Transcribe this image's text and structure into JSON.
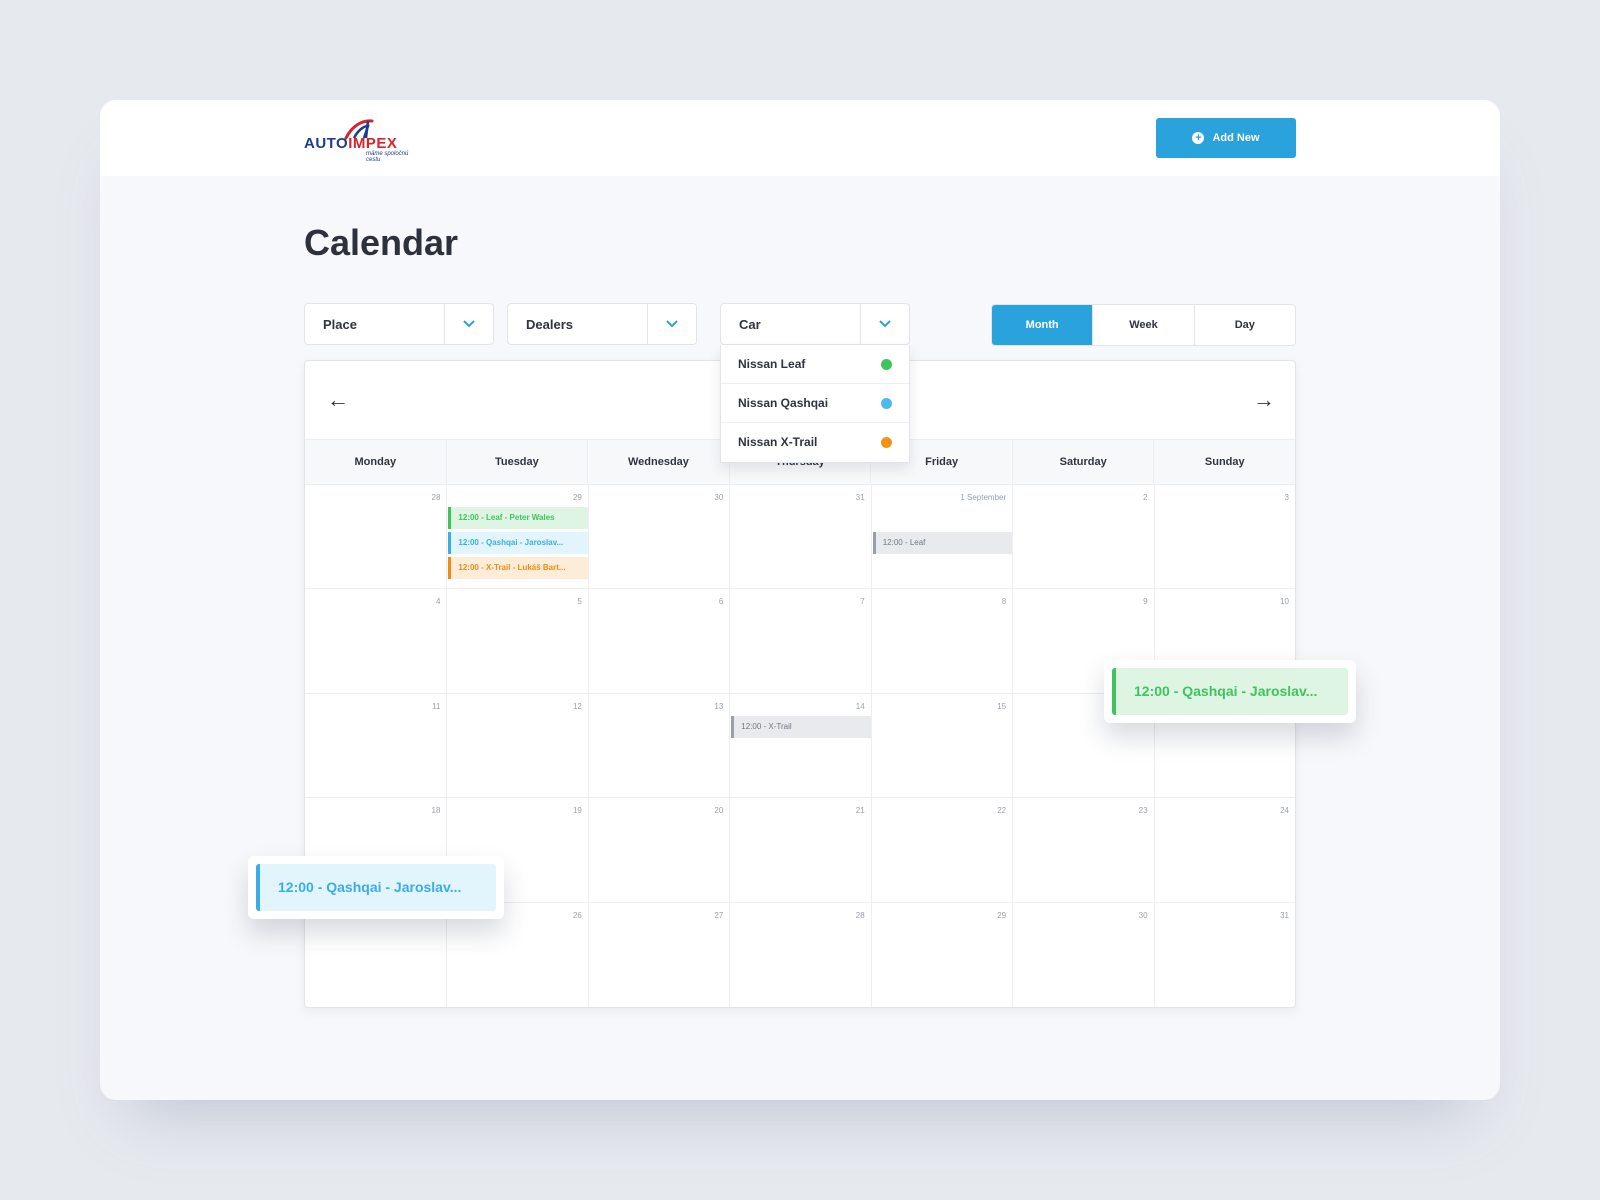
{
  "header": {
    "logo": {
      "part1": "AUTO",
      "part2": "IMPEX",
      "tagline": "máme spoločnú cestu",
      "brand_blue": "#1d3d8f",
      "brand_red": "#d6242b"
    },
    "add_new_label": "Add New",
    "add_new_icon": "plus-circle-icon",
    "accent_color": "#2aa2dc"
  },
  "page_title": "Calendar",
  "filters": {
    "place": "Place",
    "dealers": "Dealers",
    "car": "Car",
    "chevron_icon": "chevron-down-icon"
  },
  "car_dropdown": [
    {
      "label": "Nissan Leaf",
      "color": "#3fc45d"
    },
    {
      "label": "Nissan Qashqai",
      "color": "#4db8ec"
    },
    {
      "label": "Nissan X-Trail",
      "color": "#f59314"
    }
  ],
  "view_toggle": {
    "month": "Month",
    "week": "Week",
    "day": "Day",
    "active": "Month"
  },
  "calendar": {
    "prev_icon": "arrow-left-icon",
    "next_icon": "arrow-right-icon",
    "weekdays": [
      "Monday",
      "Tuesday",
      "Wednesday",
      "Thursday",
      "Friday",
      "Saturday",
      "Sunday"
    ],
    "dates": [
      "28",
      "29",
      "30",
      "31",
      "1 September",
      "2",
      "3",
      "4",
      "5",
      "6",
      "7",
      "8",
      "9",
      "10",
      "11",
      "12",
      "13",
      "14",
      "15",
      "",
      "",
      "18",
      "19",
      "20",
      "21",
      "22",
      "23",
      "24",
      "",
      "26",
      "27",
      "28",
      "29",
      "30",
      "31"
    ],
    "events": [
      {
        "cell": 1,
        "slot": 0,
        "text": "12:00 - Leaf - Peter Wales",
        "type": "green"
      },
      {
        "cell": 1,
        "slot": 1,
        "text": "12:00 - Qashqai - Jaroslav...",
        "type": "blue"
      },
      {
        "cell": 1,
        "slot": 2,
        "text": "12:00 - X-Trail - Lukáš Bart...",
        "type": "orange"
      },
      {
        "cell": 4,
        "slot": 1,
        "text": "12:00 - Leaf",
        "type": "grey"
      },
      {
        "cell": 17,
        "slot": 0,
        "text": "12:00 - X-Trail",
        "type": "grey"
      }
    ]
  },
  "floating_events": [
    {
      "text": "12:00 - Qashqai - Jaroslav...",
      "type": "green"
    },
    {
      "text": "12:00 - Qashqai - Jaroslav...",
      "type": "blue"
    }
  ]
}
